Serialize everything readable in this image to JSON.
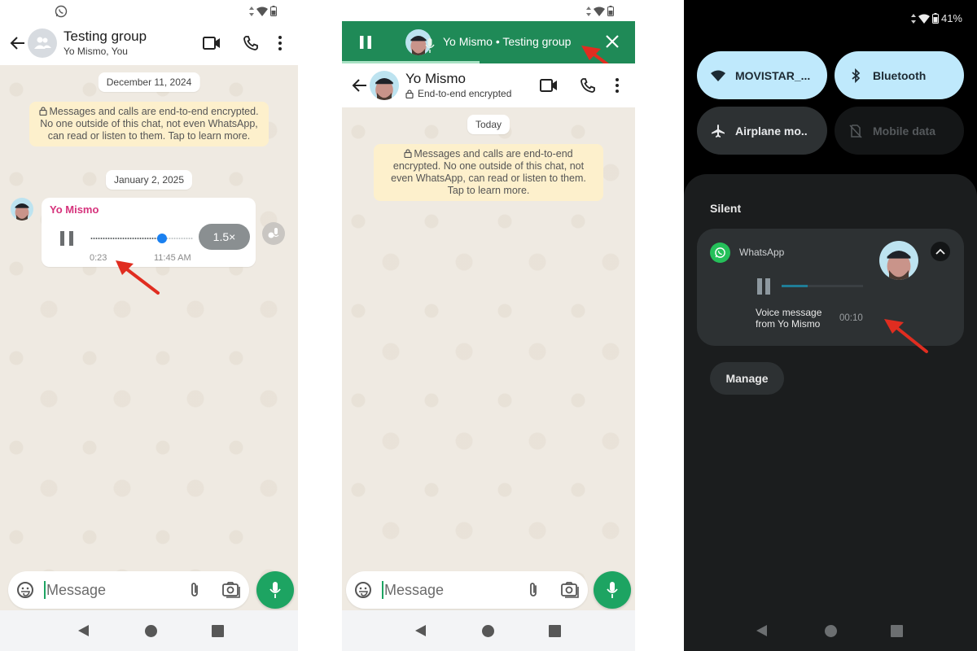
{
  "panel1": {
    "header": {
      "title": "Testing group",
      "subtitle": "Yo Mismo, You"
    },
    "chat": {
      "date_1": "December 11, 2024",
      "encryption_notice": "Messages and calls are end-to-end encrypted. No one outside of this chat, not even WhatsApp, can read or listen to them. Tap to learn more.",
      "date_2": "January 2, 2025",
      "voice_message": {
        "sender": "Yo Mismo",
        "duration": "0:23",
        "time": "11:45 AM",
        "speed": "1.5×",
        "progress_fraction": 0.7,
        "state": "playing"
      }
    },
    "composer": {
      "placeholder": "Message"
    },
    "colors": {
      "accent": "#1da462",
      "sender": "#d6337c",
      "progress_dot": "#1a80f0"
    }
  },
  "panel2": {
    "mini_player": {
      "title": "Yo Mismo • Testing group",
      "progress_fraction": 0.47,
      "state": "playing",
      "background": "#1f8a57"
    },
    "header": {
      "title": "Yo Mismo",
      "subtitle": "End-to-end encrypted"
    },
    "chat": {
      "date": "Today",
      "encryption_notice": "Messages and calls are end-to-end encrypted. No one outside of this chat, not even WhatsApp, can read or listen to them. Tap to learn more."
    },
    "composer": {
      "placeholder": "Message"
    }
  },
  "panel3": {
    "status": {
      "battery": "41%"
    },
    "quick_tiles": [
      {
        "label": "MOVISTAR_...",
        "icon": "wifi-icon",
        "state": "on"
      },
      {
        "label": "Bluetooth",
        "icon": "bluetooth-icon",
        "state": "on"
      },
      {
        "label": "Airplane mo..",
        "icon": "airplane-icon",
        "state": "off"
      },
      {
        "label": "Mobile data",
        "icon": "mobile-data-off-icon",
        "state": "disabled"
      }
    ],
    "section_label": "Silent",
    "notification": {
      "app": "WhatsApp",
      "title": "Voice message\nfrom Yo Mismo",
      "duration": "00:10",
      "progress_fraction": 0.32,
      "state": "paused"
    },
    "manage_label": "Manage"
  },
  "icons": {
    "status_app": "whatsapp-icon",
    "back": "arrow-left-icon",
    "video": "video-call-icon",
    "call": "phone-icon",
    "more": "more-vertical-icon",
    "emoji": "sticker-icon",
    "attach": "paperclip-icon",
    "camera": "camera-icon",
    "mic": "microphone-icon"
  }
}
